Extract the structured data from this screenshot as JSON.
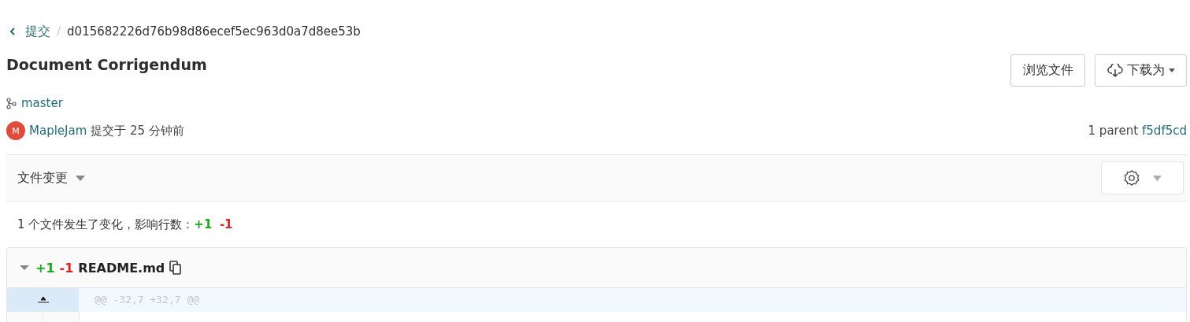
{
  "breadcrumb": {
    "parent": "提交",
    "separator": "/",
    "sha": "d015682226d76b98d86ecef5ec963d0a7d8ee53b"
  },
  "title": "Document Corrigendum",
  "buttons": [
    {
      "label": "浏览文件",
      "kind": "plain"
    },
    {
      "label": "下载为",
      "kind": "download"
    }
  ],
  "branch": "master",
  "author": {
    "avatar": "M",
    "name": "MapleJam",
    "action": "提交于 25 分钟前"
  },
  "parents": {
    "label": "1 parent",
    "sha": "f5df5cd"
  },
  "changes_bar": {
    "label": "文件变更"
  },
  "summary": {
    "text": "1 个文件发生了变化，影响行数：",
    "added": "+1",
    "removed": "-1"
  },
  "files": [
    {
      "added": "+1",
      "removed": "-1",
      "name": "README.md",
      "expanded": true,
      "hunk": "@@ -32,7 +32,7 @@"
    }
  ]
}
